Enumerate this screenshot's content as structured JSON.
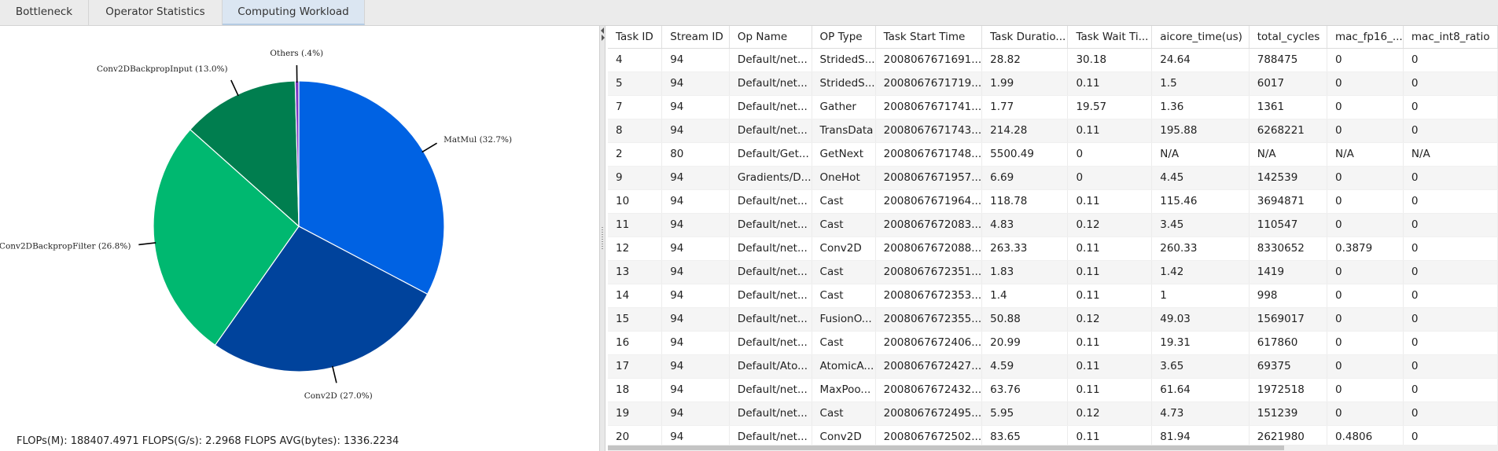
{
  "tabs": [
    {
      "label": "Bottleneck"
    },
    {
      "label": "Operator Statistics"
    },
    {
      "label": "Computing Workload"
    }
  ],
  "chart_data": {
    "type": "pie",
    "slices": [
      {
        "label": "MatMul (32.7%)",
        "name": "MatMul",
        "value": 32.7,
        "color": "#0062e3"
      },
      {
        "label": "Conv2D (27.0%)",
        "name": "Conv2D",
        "value": 27.0,
        "color": "#00439c"
      },
      {
        "label": "Conv2DBackpropFilter (26.8%)",
        "name": "Conv2DBackpropFilter",
        "value": 26.8,
        "color": "#00b870"
      },
      {
        "label": "Conv2DBackpropInput (13.0%)",
        "name": "Conv2DBackpropInput",
        "value": 13.0,
        "color": "#007e4f"
      },
      {
        "label": "Others (.4%)",
        "name": "Others",
        "value": 0.4,
        "color": "#7a36c2"
      }
    ]
  },
  "flops_summary": "FLOPs(M): 188407.4971 FLOPS(G/s): 2.2968 FLOPS AVG(bytes): 1336.2234",
  "table": {
    "columns": [
      "Task ID",
      "Stream ID",
      "Op Name",
      "OP Type",
      "Task Start Time",
      "Task Duratio...",
      "Task Wait Ti...",
      "aicore_time(us)",
      "total_cycles",
      "mac_fp16_...",
      "mac_int8_ratio"
    ],
    "rows": [
      [
        "4",
        "94",
        "Default/net...",
        "StridedS...",
        "2008067671691...",
        "28.82",
        "30.18",
        "24.64",
        "788475",
        "0",
        "0"
      ],
      [
        "5",
        "94",
        "Default/net...",
        "StridedS...",
        "2008067671719...",
        "1.99",
        "0.11",
        "1.5",
        "6017",
        "0",
        "0"
      ],
      [
        "7",
        "94",
        "Default/net...",
        "Gather",
        "2008067671741...",
        "1.77",
        "19.57",
        "1.36",
        "1361",
        "0",
        "0"
      ],
      [
        "8",
        "94",
        "Default/net...",
        "TransData",
        "2008067671743...",
        "214.28",
        "0.11",
        "195.88",
        "6268221",
        "0",
        "0"
      ],
      [
        "2",
        "80",
        "Default/Get...",
        "GetNext",
        "2008067671748...",
        "5500.49",
        "0",
        "N/A",
        "N/A",
        "N/A",
        "N/A"
      ],
      [
        "9",
        "94",
        "Gradients/D...",
        "OneHot",
        "2008067671957...",
        "6.69",
        "0",
        "4.45",
        "142539",
        "0",
        "0"
      ],
      [
        "10",
        "94",
        "Default/net...",
        "Cast",
        "2008067671964...",
        "118.78",
        "0.11",
        "115.46",
        "3694871",
        "0",
        "0"
      ],
      [
        "11",
        "94",
        "Default/net...",
        "Cast",
        "2008067672083...",
        "4.83",
        "0.12",
        "3.45",
        "110547",
        "0",
        "0"
      ],
      [
        "12",
        "94",
        "Default/net...",
        "Conv2D",
        "2008067672088...",
        "263.33",
        "0.11",
        "260.33",
        "8330652",
        "0.3879",
        "0"
      ],
      [
        "13",
        "94",
        "Default/net...",
        "Cast",
        "2008067672351...",
        "1.83",
        "0.11",
        "1.42",
        "1419",
        "0",
        "0"
      ],
      [
        "14",
        "94",
        "Default/net...",
        "Cast",
        "2008067672353...",
        "1.4",
        "0.11",
        "1",
        "998",
        "0",
        "0"
      ],
      [
        "15",
        "94",
        "Default/net...",
        "FusionO...",
        "2008067672355...",
        "50.88",
        "0.12",
        "49.03",
        "1569017",
        "0",
        "0"
      ],
      [
        "16",
        "94",
        "Default/net...",
        "Cast",
        "2008067672406...",
        "20.99",
        "0.11",
        "19.31",
        "617860",
        "0",
        "0"
      ],
      [
        "17",
        "94",
        "Default/Ato...",
        "AtomicA...",
        "2008067672427...",
        "4.59",
        "0.11",
        "3.65",
        "69375",
        "0",
        "0"
      ],
      [
        "18",
        "94",
        "Default/net...",
        "MaxPoo...",
        "2008067672432...",
        "63.76",
        "0.11",
        "61.64",
        "1972518",
        "0",
        "0"
      ],
      [
        "19",
        "94",
        "Default/net...",
        "Cast",
        "2008067672495...",
        "5.95",
        "0.12",
        "4.73",
        "151239",
        "0",
        "0"
      ],
      [
        "20",
        "94",
        "Default/net...",
        "Conv2D",
        "2008067672502...",
        "83.65",
        "0.11",
        "81.94",
        "2621980",
        "0.4806",
        "0"
      ]
    ]
  }
}
